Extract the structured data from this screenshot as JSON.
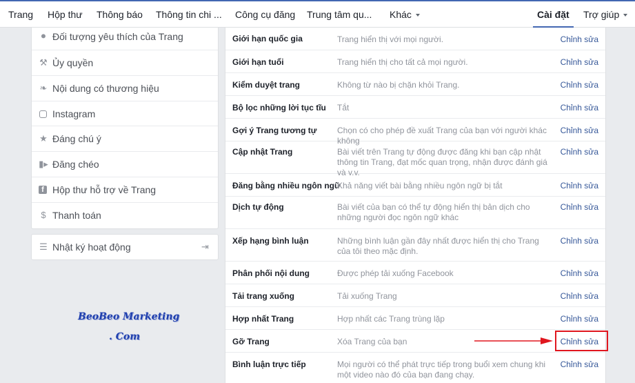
{
  "nav": {
    "items": [
      "Trang",
      "Hộp thư",
      "Thông báo",
      "Thông tin chi ...",
      "Công cụ đăng",
      "Trung tâm qu...",
      "Khác",
      "Cài đặt",
      "Trợ giúp"
    ]
  },
  "sidebar": {
    "items": [
      {
        "label": "Đối tượng yêu thích của Trang",
        "icon": "audience-icon"
      },
      {
        "label": "Ủy quyền",
        "icon": "wrench-icon"
      },
      {
        "label": "Nội dung có thương hiệu",
        "icon": "handshake-icon"
      },
      {
        "label": "Instagram",
        "icon": "instagram-icon"
      },
      {
        "label": "Đáng chú ý",
        "icon": "star-icon"
      },
      {
        "label": "Đăng chéo",
        "icon": "video-icon"
      },
      {
        "label": "Hộp thư hỗ trợ về Trang",
        "icon": "facebook-icon"
      },
      {
        "label": "Thanh toán",
        "icon": "dollar-icon"
      }
    ],
    "activity_log": {
      "label": "Nhật ký hoạt động",
      "icon": "list-icon"
    }
  },
  "watermark": {
    "line1": "BeoBeo Marketing",
    "line2": ". Com"
  },
  "settings": {
    "edit_label": "Chỉnh sửa",
    "rows": [
      {
        "label": "Giới hạn quốc gia",
        "value": "Trang hiển thị với mọi người."
      },
      {
        "label": "Giới hạn tuổi",
        "value": "Trang hiển thị cho tất cả mọi người."
      },
      {
        "label": "Kiểm duyệt trang",
        "value": "Không từ nào bị chặn khỏi Trang."
      },
      {
        "label": "Bộ lọc những lời tục tĩu",
        "value": "Tắt"
      },
      {
        "label": "Gợi ý Trang tương tự",
        "value": "Chọn có cho phép đề xuất Trang của bạn với người khác không"
      },
      {
        "label": "Cập nhật Trang",
        "value": "Bài viết trên Trang tự động được đăng khi bạn cập nhật thông tin Trang, đạt mốc quan trọng, nhận được đánh giá và v.v."
      },
      {
        "label": "Đăng bằng nhiều ngôn ngữ",
        "value": "Khả năng viết bài bằng nhiều ngôn ngữ bị tắt"
      },
      {
        "label": "Dịch tự động",
        "value": "Bài viết của bạn có thể tự động hiển thị bản dịch cho những người đọc ngôn ngữ khác"
      },
      {
        "label": "Xếp hạng bình luận",
        "value": "Những bình luận gần đây nhất được hiển thị cho Trang của tôi theo mặc định."
      },
      {
        "label": "Phân phối nội dung",
        "value": "Được phép tải xuống Facebook"
      },
      {
        "label": "Tải trang xuống",
        "value": "Tải xuống Trang"
      },
      {
        "label": "Hợp nhất Trang",
        "value": "Hợp nhất các Trang trùng lặp"
      },
      {
        "label": "Gỡ Trang",
        "value": "Xóa Trang của bạn"
      },
      {
        "label": "Bình luận trực tiếp",
        "value": "Mọi người có thể phát trực tiếp trong buổi xem chung khi một video nào đó của bạn đang chạy."
      }
    ]
  },
  "colors": {
    "accent": "#4267b2",
    "link": "#365899",
    "highlight": "#e0161e"
  }
}
